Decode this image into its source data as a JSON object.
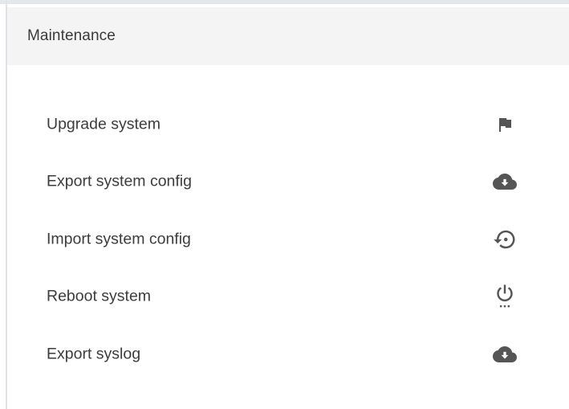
{
  "card": {
    "title": "Maintenance"
  },
  "menu": {
    "items": [
      {
        "label": "Upgrade system",
        "icon": "flag-icon"
      },
      {
        "label": "Export system config",
        "icon": "cloud-download-icon"
      },
      {
        "label": "Import system config",
        "icon": "restore-icon"
      },
      {
        "label": "Reboot system",
        "icon": "power-settings-icon"
      },
      {
        "label": "Export syslog",
        "icon": "cloud-download-icon"
      }
    ]
  },
  "colors": {
    "header_bg": "#f4f4f4",
    "text": "#3c3c3c",
    "icon": "#555555"
  }
}
